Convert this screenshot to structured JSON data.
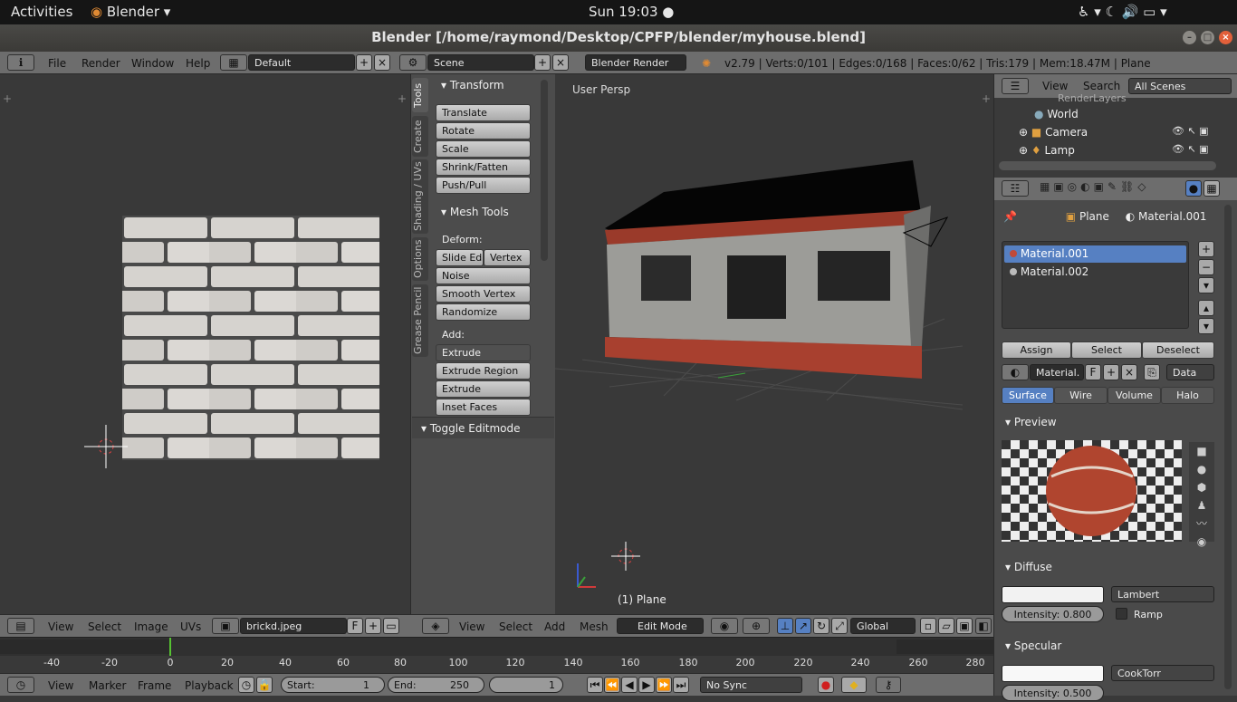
{
  "topbar": {
    "activities": "Activities",
    "app": "Blender ▾",
    "clock": "Sun 19:03 ●",
    "tray": "♿ ▾   ☾  🔊  ▭ ▾"
  },
  "titlebar": {
    "title": "Blender [/home/raymond/Desktop/CPFP/blender/myhouse.blend]",
    "min": "–",
    "max": "□",
    "close": "×"
  },
  "info": {
    "file": "File",
    "render": "Render",
    "window": "Window",
    "help": "Help",
    "layout": "Default",
    "scene": "Scene",
    "engine": "Blender Render",
    "stats": "v2.79 | Verts:0/101 | Edges:0/168 | Faces:0/62 | Tris:179 | Mem:18.47M | Plane"
  },
  "uv": {
    "view": "View",
    "select": "Select",
    "image": "Image",
    "uvs": "UVs",
    "imagename": "brickd.jpeg",
    "f": "F"
  },
  "tools": {
    "tabs": [
      "Tools",
      "Create",
      "Shading / UVs",
      "Options",
      "Grease Pencil"
    ],
    "transform": "Transform",
    "translate": "Translate",
    "rotate": "Rotate",
    "scale": "Scale",
    "shrink": "Shrink/Fatten",
    "push": "Push/Pull",
    "meshtools": "Mesh Tools",
    "deform": "Deform:",
    "slide": "Slide Ed",
    "vertex": "Vertex",
    "noise": "Noise",
    "smooth": "Smooth Vertex",
    "randomize": "Randomize",
    "add": "Add:",
    "extrude": "Extrude",
    "extrude_region": "Extrude Region",
    "extrude_ind": "Extrude Individual",
    "inset": "Inset Faces",
    "toggle": "Toggle Editmode"
  },
  "viewport": {
    "persp": "User Persp",
    "object": "(1) Plane",
    "view": "View",
    "select": "Select",
    "add": "Add",
    "mesh": "Mesh",
    "mode": "Edit Mode",
    "orientation": "Global"
  },
  "outliner": {
    "view": "View",
    "search": "Search",
    "scenes": "All Scenes",
    "renderlayers": "RenderLayers",
    "world": "World",
    "camera": "Camera",
    "lamp": "Lamp"
  },
  "props": {
    "plane": "Plane",
    "material": "Material.001",
    "slots": [
      "Material.001",
      "Material.002"
    ],
    "assign": "Assign",
    "select": "Select",
    "deselect": "Deselect",
    "matname": "Material.",
    "f": "F",
    "data": "Data",
    "surface": "Surface",
    "wire": "Wire",
    "volume": "Volume",
    "halo": "Halo",
    "preview": "Preview",
    "diffuse": "Diffuse",
    "lambert": "Lambert",
    "intensity": "Intensity:",
    "diff_int": "0.800",
    "ramp": "Ramp",
    "specular": "Specular",
    "cooktorr": "CookTorr",
    "spec_int": "0.500"
  },
  "timeline": {
    "ticks": [
      "-40",
      "-20",
      "0",
      "20",
      "40",
      "60",
      "80",
      "100",
      "120",
      "140",
      "160",
      "180",
      "200",
      "220",
      "240",
      "260",
      "280"
    ],
    "view": "View",
    "marker": "Marker",
    "frame": "Frame",
    "playback": "Playback",
    "start_label": "Start:",
    "start": "1",
    "end_label": "End:",
    "end": "250",
    "current": "1",
    "sync": "No Sync"
  }
}
